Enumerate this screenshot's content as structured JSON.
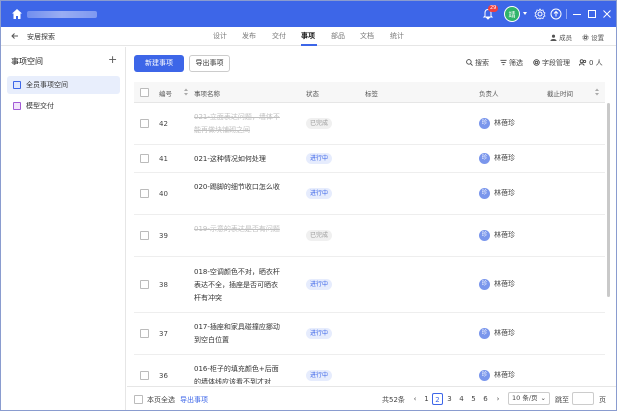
{
  "topbar": {
    "notification_count": "29",
    "user_avatar_text": "靖"
  },
  "nav": {
    "project": "安居探索",
    "tabs": [
      "设计",
      "发布",
      "交付",
      "事项",
      "部品",
      "文档",
      "统计"
    ],
    "members_label": "成员",
    "settings_label": "设置"
  },
  "sidebar": {
    "title": "事项空间",
    "items": [
      {
        "label": "全员事项空间",
        "selected": true
      },
      {
        "label": "模型交付",
        "selected": false
      }
    ]
  },
  "toolbar": {
    "new_label": "新建事项",
    "export_label": "导出事项",
    "search_label": "搜索",
    "filter_label": "筛选",
    "fields_label": "字段管理",
    "people_label": "0 人"
  },
  "table": {
    "headers": {
      "id": "编号",
      "name": "事项名称",
      "status": "状态",
      "tags": "标签",
      "assignee": "负责人",
      "deadline": "截止时间"
    },
    "rows": [
      {
        "id": "42",
        "name": "021-立面表达问题，墙体不能再做块铺砌之间",
        "status": "已完成",
        "done": true,
        "assignee": "林蓓珍",
        "av": "珍"
      },
      {
        "id": "41",
        "name": "021-这种情况如何处理",
        "status": "进行中",
        "done": false,
        "assignee": "林蓓珍",
        "av": "珍"
      },
      {
        "id": "40",
        "name": "020-踢脚的细节收口怎么收",
        "status": "进行中",
        "done": false,
        "assignee": "林蓓珍",
        "av": "珍"
      },
      {
        "id": "39",
        "name": "019-示意的表达是否有问题",
        "status": "已完成",
        "done": true,
        "assignee": "林蓓珍",
        "av": "珍"
      },
      {
        "id": "38",
        "name": "018-空调颜色不对，晒衣杆表达不全，插座是否可晒衣杆有冲突",
        "status": "进行中",
        "done": false,
        "assignee": "林蓓珍",
        "av": "珍"
      },
      {
        "id": "37",
        "name": "017-插座和家具碰撞应挪动到空白位置",
        "status": "进行中",
        "done": false,
        "assignee": "林蓓珍",
        "av": "珍"
      },
      {
        "id": "36",
        "name": "016-柜子的填充颜色+后面的墙体线应该看不到才对",
        "status": "进行中",
        "done": false,
        "assignee": "林蓓珍",
        "av": "珍"
      }
    ]
  },
  "footer": {
    "select_all": "本页全选",
    "export": "导出事项",
    "total": "共52条",
    "pages": [
      "1",
      "2",
      "3",
      "4",
      "5",
      "6"
    ],
    "current_page": "2",
    "page_size": "10 条/页",
    "jump": "跳至",
    "page_unit": "页"
  },
  "colors": {
    "accent": "#3d66e8",
    "done_text": "#c0c0c0",
    "in_progress_bg": "#e6ecfd"
  }
}
